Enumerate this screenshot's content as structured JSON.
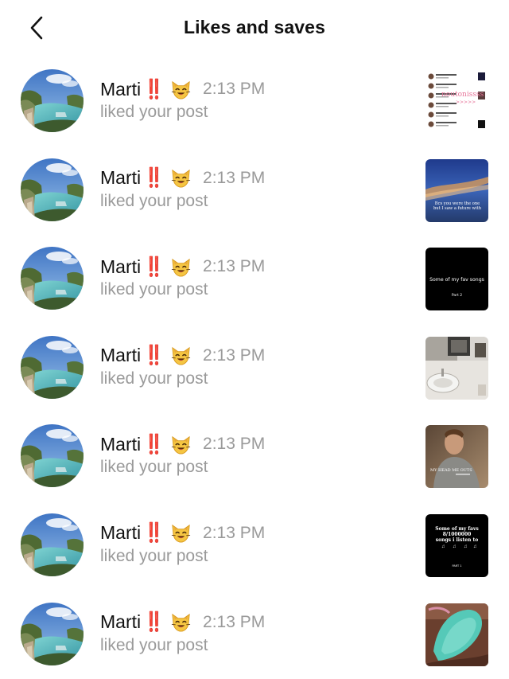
{
  "header": {
    "title": "Likes and saves",
    "back_icon": "chevron-left-icon"
  },
  "notifications": [
    {
      "username": "Marti",
      "badge": "‼️",
      "emoji": "cat-face-icon",
      "time": "2:13 PM",
      "action": "liked your post",
      "thumb": "comment-list-screenshot",
      "thumb_text": "noutonissss"
    },
    {
      "username": "Marti",
      "badge": "‼️",
      "emoji": "cat-face-icon",
      "time": "2:13 PM",
      "action": "liked your post",
      "thumb": "sky-photo",
      "thumb_text": "Bcs you were the one but I saw a future with"
    },
    {
      "username": "Marti",
      "badge": "‼️",
      "emoji": "cat-face-icon",
      "time": "2:13 PM",
      "action": "liked your post",
      "thumb": "black-text",
      "thumb_text": "Some of my fav songs",
      "thumb_sub": "Part 2"
    },
    {
      "username": "Marti",
      "badge": "‼️",
      "emoji": "cat-face-icon",
      "time": "2:13 PM",
      "action": "liked your post",
      "thumb": "bathroom-photo",
      "thumb_text": ""
    },
    {
      "username": "Marti",
      "badge": "‼️",
      "emoji": "cat-face-icon",
      "time": "2:13 PM",
      "action": "liked your post",
      "thumb": "portrait-photo",
      "thumb_text": "MY HEAD ME OUTS"
    },
    {
      "username": "Marti",
      "badge": "‼️",
      "emoji": "cat-face-icon",
      "time": "2:13 PM",
      "action": "liked your post",
      "thumb": "black-text",
      "thumb_text": "Some of my favs 8/1000000 songs i listen to",
      "thumb_sub": "PART 1"
    },
    {
      "username": "Marti",
      "badge": "‼️",
      "emoji": "cat-face-icon",
      "time": "2:13 PM",
      "action": "liked your post",
      "thumb": "teal-object-photo",
      "thumb_text": ""
    }
  ],
  "colors": {
    "title": "#111111",
    "secondary_text": "#9a9a9a",
    "badge_red": "#e0242a"
  }
}
